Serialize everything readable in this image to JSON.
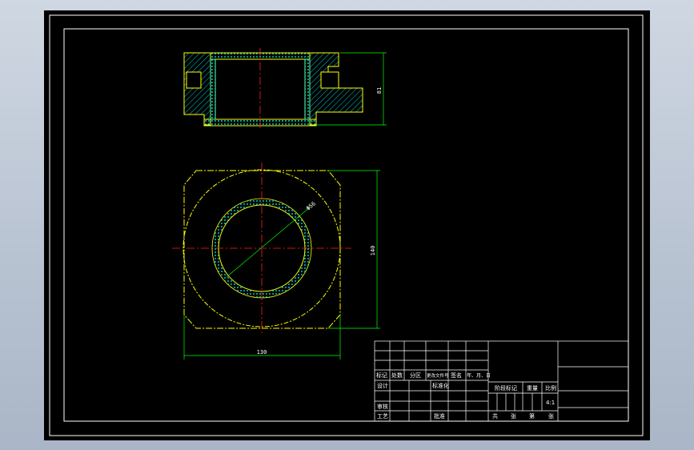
{
  "app": {
    "background": "#bcc6d4",
    "canvas_color": "#000000"
  },
  "colors": {
    "frame": "#ffffff",
    "part_outline": "#ffff00",
    "centerline": "#ff2020",
    "hatch": "#00ffff",
    "dimension": "#00ff00",
    "text": "#ffffff"
  },
  "dimensions": {
    "side_height": "81",
    "plan_height": "140",
    "plan_width": "130",
    "diameter": "Φ56"
  },
  "title_block": {
    "row_labels": {
      "mark": "标记",
      "count": "处数",
      "zone": "分区",
      "doc_no": "更改文件号",
      "sign": "签名",
      "date": "年、月、日"
    },
    "design": "设计",
    "standardize": "标准化",
    "review": "审核",
    "process": "工艺",
    "approve": "批准",
    "stage_mark": "阶段标记",
    "weight": "重量",
    "scale_label": "比例",
    "scale_value": "4:1",
    "total": "共",
    "sheets": "张",
    "sheet_no": "第",
    "sheet_unit": "张"
  }
}
